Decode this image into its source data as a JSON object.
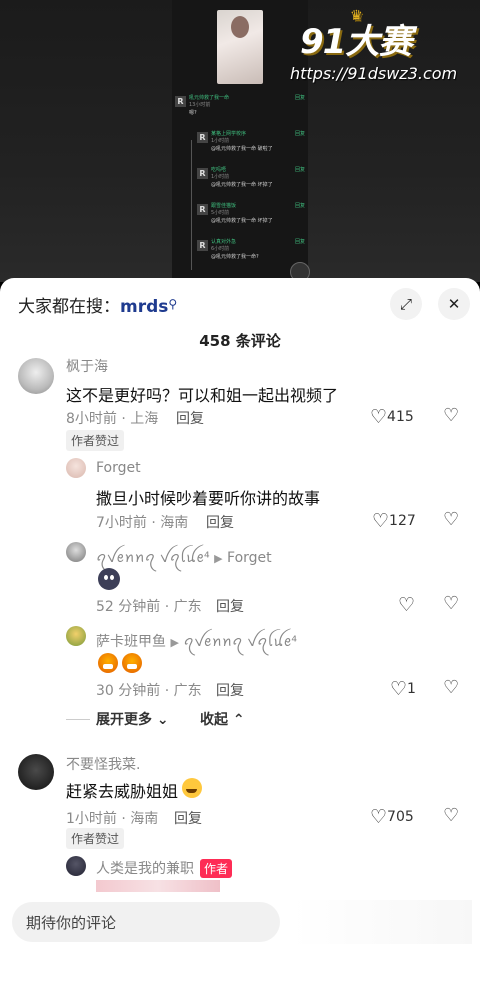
{
  "watermark": {
    "brand": "91大赛",
    "url": "https://91dswz3.com"
  },
  "inner_screenshot": {
    "rows": [
      {
        "name": "吼元帅救了我一命",
        "time": "13小时前",
        "text": "嗯?",
        "reply": "回复"
      },
      {
        "name": "某格上网学校序",
        "time": "1小时前",
        "text": "@吼元帅救了我一命 破啦了",
        "reply": "回复"
      },
      {
        "name": "吃吗唔",
        "time": "1小时前",
        "text": "@吼元帅救了我一命 坏掉了",
        "reply": "回复"
      },
      {
        "name": "跟雪佳猫饭",
        "time": "5小时前",
        "text": "@吼元帅救了我一命 坏掉了",
        "reply": "回复"
      },
      {
        "name": "认真对外急",
        "time": "6小时前",
        "text": "@吼元帅救了我一命?",
        "reply": "回复"
      }
    ]
  },
  "header": {
    "search_prefix": "大家都在搜：",
    "search_term": "mrds",
    "count_label": "458 条评论"
  },
  "comments": [
    {
      "name": "枫于海",
      "text": "这不是更好吗？可以和姐一起出视频了",
      "meta": "8小时前 · 上海",
      "reply": "回复",
      "likes": "415",
      "tag": "作者赞过"
    },
    {
      "name": "Forget",
      "text": "撒旦小时候吵着要听你讲的故事",
      "meta": "7小时前 · 海南",
      "reply": "回复",
      "likes": "127"
    },
    {
      "name": "ꪖꪜꫀꪀꪀꪖ ꪜꪖꪶꪊꫀ⁴",
      "reply_to": "Forget",
      "meta": "52 分钟前 · 广东",
      "reply": "回复",
      "likes": ""
    },
    {
      "name": "萨卡班甲鱼",
      "reply_to": "ꪖꪜꫀꪀꪀꪖ ꪜꪖꪶꪊꫀ⁴",
      "meta": "30 分钟前 · 广东",
      "reply": "回复",
      "likes": "1"
    },
    {
      "name": "不要怪我菜.",
      "text": "赶紧去威胁姐姐",
      "meta": "1小时前 · 海南",
      "reply": "回复",
      "likes": "705",
      "tag": "作者赞过"
    },
    {
      "name": "人类是我的兼职",
      "author_tag": "作者"
    }
  ],
  "thread_controls": {
    "expand": "展开更多",
    "collapse": "收起"
  },
  "input": {
    "placeholder": "期待你的评论"
  },
  "colors": {
    "accent_blue": "#1f3b8f",
    "author_red": "#fe2c55"
  }
}
